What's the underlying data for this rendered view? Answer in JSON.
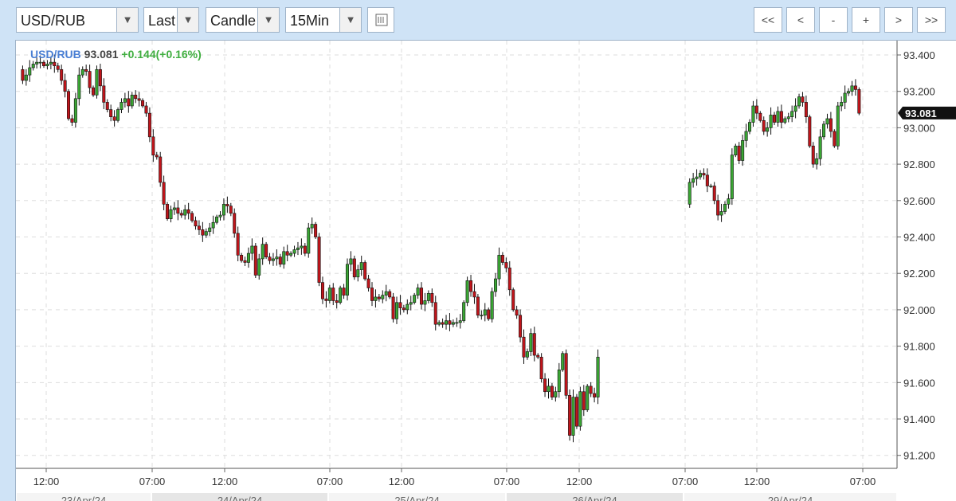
{
  "toolbar": {
    "symbol": "USD/RUB",
    "price_mode": "Last",
    "chart_type": "Candle",
    "interval": "15Min",
    "nav_buttons": [
      "<<",
      "<",
      "-",
      "+",
      ">",
      ">>"
    ]
  },
  "header": {
    "symbol": "USD/RUB",
    "price": "93.081",
    "change": "+0.144(+0.16%)"
  },
  "colors": {
    "up": "#3aa634",
    "down": "#c0151b",
    "wick": "#111111",
    "symbol": "#4a7fd4",
    "change": "#3fae3f"
  },
  "chart_data": {
    "type": "candlestick",
    "y_ticks": [
      "93.400",
      "93.200",
      "93.000",
      "92.800",
      "92.600",
      "92.400",
      "92.200",
      "92.000",
      "91.800",
      "91.600",
      "91.400",
      "91.200"
    ],
    "ylim": [
      91.12,
      93.47
    ],
    "last_price_label": "93.081",
    "x_ticks": [
      "12:00",
      "07:00",
      "12:00",
      "07:00",
      "12:00",
      "07:00",
      "12:00",
      "07:00",
      "12:00",
      "07:00"
    ],
    "date_labels": [
      "23/Apr/24",
      "24/Apr/24",
      "25/Apr/24",
      "26/Apr/24",
      "29/Apr/24"
    ],
    "grid": true,
    "segments": [
      {
        "start_index": 0,
        "points": [
          93.32,
          93.26,
          93.29,
          93.33,
          93.35,
          93.36,
          93.36,
          93.34,
          93.35,
          93.36,
          93.34,
          93.32,
          93.26,
          93.2,
          93.05,
          93.03,
          93.16,
          93.29,
          93.32,
          93.31,
          93.22,
          93.18,
          93.32,
          93.23,
          93.14,
          93.1,
          93.06,
          93.04,
          93.1,
          93.14,
          93.16,
          93.12,
          93.18,
          93.16,
          93.15,
          93.12,
          93.08,
          92.95,
          92.85,
          92.84,
          92.7,
          92.58,
          92.5,
          92.55,
          92.56,
          92.53,
          92.52,
          92.55,
          92.53,
          92.49,
          92.46,
          92.44,
          92.41,
          92.43,
          92.45,
          92.48,
          92.51,
          92.52,
          92.58,
          92.57,
          92.53,
          92.42,
          92.3,
          92.27,
          92.26,
          92.31,
          92.35,
          92.19,
          92.28,
          92.36,
          92.29,
          92.27,
          92.28,
          92.29,
          92.25,
          92.32,
          92.3,
          92.31,
          92.33,
          92.34,
          92.35,
          92.31,
          92.45,
          92.47,
          92.4,
          92.15,
          92.06,
          92.05,
          92.12,
          92.05,
          92.04,
          92.12,
          92.08,
          92.25,
          92.28,
          92.18,
          92.22,
          92.26,
          92.17,
          92.12,
          92.05,
          92.07,
          92.06,
          92.08,
          92.1,
          92.07,
          91.95,
          92.04,
          92.01,
          92.0,
          92.03,
          92.04,
          92.08,
          92.12,
          92.03,
          92.05,
          92.09,
          92.04,
          91.92,
          91.93,
          91.92,
          91.94,
          91.92,
          91.93,
          91.93,
          91.94,
          92.04,
          92.16,
          92.1,
          92.07,
          91.97,
          91.97,
          92.0,
          91.95,
          92.1,
          92.17,
          92.3,
          92.26,
          92.23,
          92.11,
          92.0,
          91.97,
          91.85,
          91.74,
          91.77,
          91.87,
          91.75,
          91.74,
          91.62,
          91.55,
          91.58,
          91.52,
          91.55,
          91.67,
          91.76,
          91.53,
          91.31,
          91.52,
          91.36,
          91.55,
          91.45,
          91.58,
          91.54,
          91.52,
          91.74
        ]
      },
      {
        "start_index": 189,
        "points": [
          92.58,
          92.7,
          92.72,
          92.73,
          92.75,
          92.74,
          92.68,
          92.68,
          92.6,
          92.52,
          92.54,
          92.58,
          92.61,
          92.85,
          92.9,
          92.82,
          92.93,
          92.98,
          93.03,
          93.12,
          93.08,
          93.04,
          92.98,
          93.0,
          93.07,
          93.03,
          93.09,
          93.03,
          93.05,
          93.06,
          93.09,
          93.12,
          93.17,
          93.14,
          93.06,
          92.9,
          92.8,
          92.83,
          92.95,
          93.02,
          93.05,
          92.98,
          92.9,
          93.12,
          93.14,
          93.19,
          93.2,
          93.23,
          93.21,
          93.08
        ]
      }
    ]
  }
}
